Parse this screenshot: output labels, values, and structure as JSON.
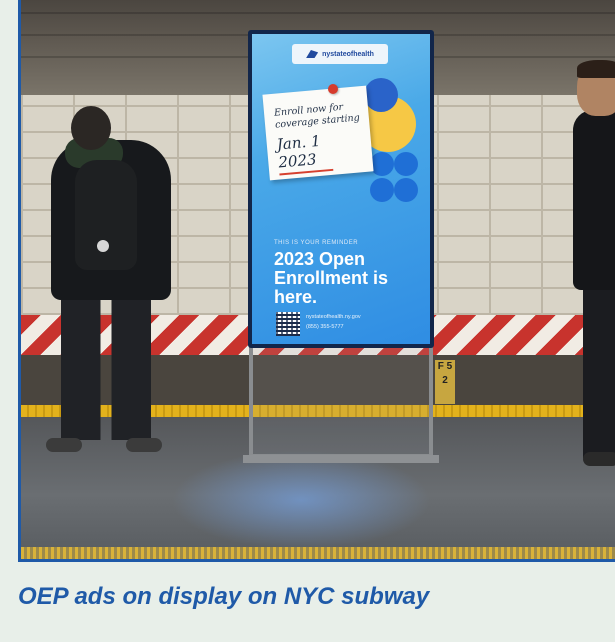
{
  "photo": {
    "ad": {
      "brand": "nystateofhealth",
      "note_line1": "Enroll now for",
      "note_line2": "coverage starting",
      "note_date": "Jan. 1 2023",
      "reminder": "THIS IS YOUR REMINDER",
      "headline": "2023 Open Enrollment is here.",
      "website": "nystateofhealth.ny.gov",
      "phone": "(855) 355-5777"
    },
    "platform_sign": "F 5 2"
  },
  "caption": "OEP ads on display on NYC subway"
}
